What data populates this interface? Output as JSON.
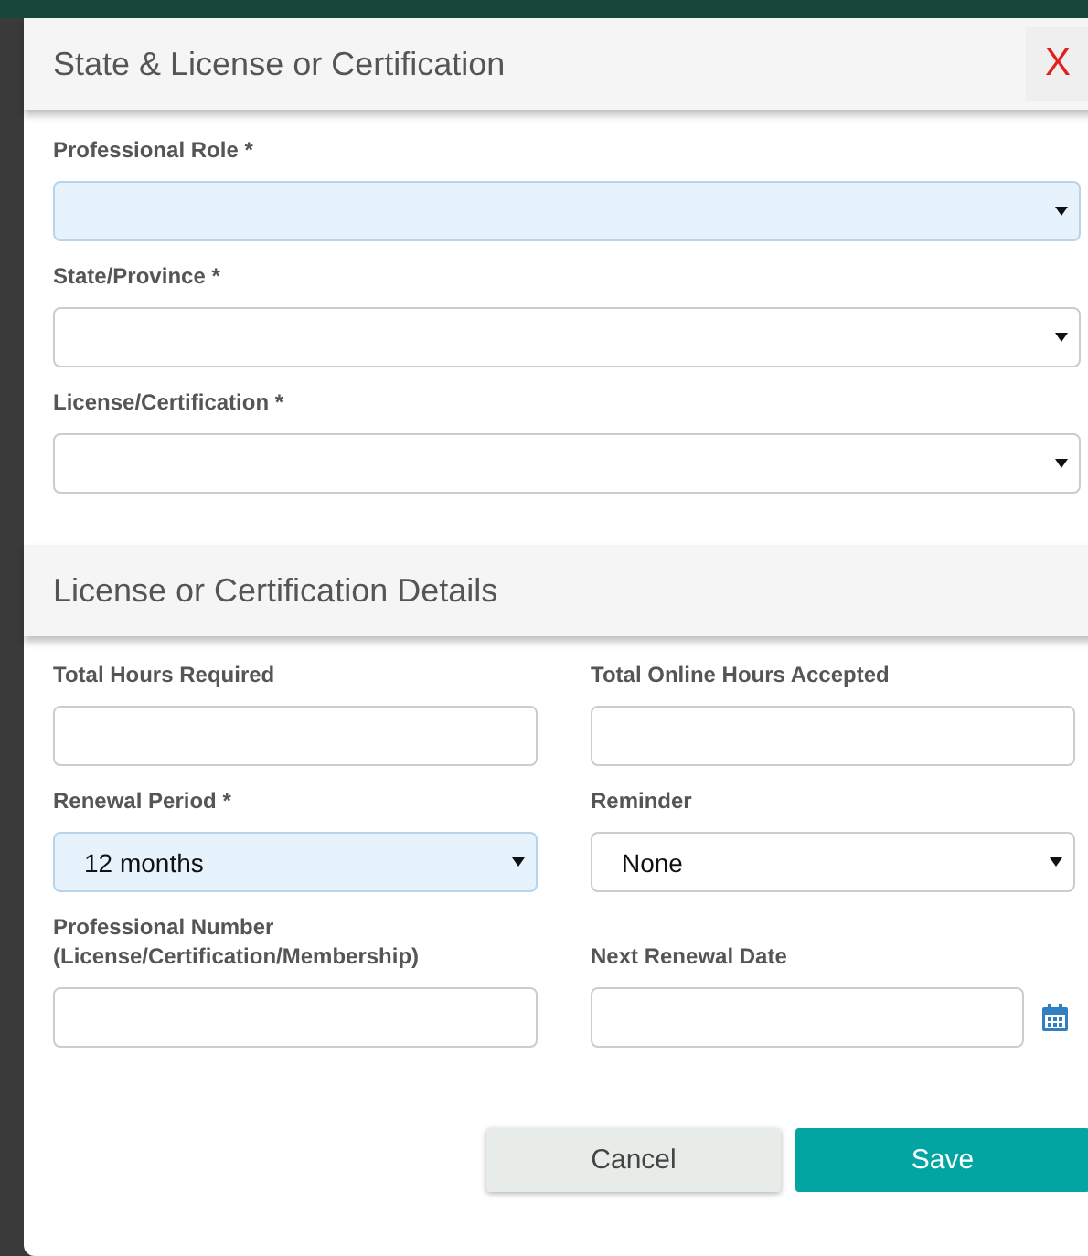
{
  "dialog": {
    "title": "State & License or Certification",
    "close": "X"
  },
  "top_fields": [
    {
      "label": "Professional Role *",
      "kind": "select",
      "highlighted": true
    },
    {
      "label": "State/Province *",
      "kind": "select",
      "highlighted": false
    },
    {
      "label": "License/Certification *",
      "kind": "select",
      "highlighted": false
    }
  ],
  "details": {
    "title": "License or Certification Details",
    "fields": [
      {
        "label": "Total Hours Required",
        "kind": "text",
        "highlighted": false
      },
      {
        "label": "Total Online Hours Accepted",
        "kind": "text",
        "highlighted": false
      },
      {
        "label": "Renewal Period *",
        "kind": "select",
        "value": "12 months",
        "highlighted": true
      },
      {
        "label": "Reminder",
        "kind": "select",
        "value": "None",
        "highlighted": false
      },
      {
        "label": "Professional Number\n(License/Certification/Membership)",
        "kind": "text",
        "highlighted": false
      },
      {
        "label": "Next Renewal Date",
        "kind": "date",
        "highlighted": false
      }
    ]
  },
  "buttons": [
    {
      "label": "Cancel",
      "kind": "secondary"
    },
    {
      "label": "Save",
      "kind": "primary"
    }
  ]
}
